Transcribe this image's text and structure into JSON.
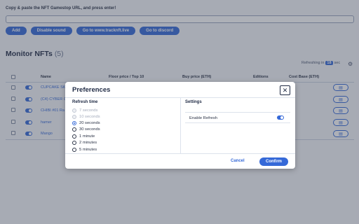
{
  "page": {
    "prompt": "Copy & paste the NFT Gamestop URL, and press enter!",
    "buttons": {
      "add": "Add",
      "disable_sound": "Disable sound",
      "go_tracknft": "Go to www.tracknft.live",
      "go_discord": "Go to discord"
    },
    "monitor": {
      "title": "Monitor NFTs",
      "count": "(5)",
      "refresh_prefix": "Refreshing in",
      "refresh_value": "18",
      "refresh_suffix": "sec"
    },
    "table": {
      "columns": [
        "Name",
        "Floor price / Top 10",
        "Buy price (ETH)",
        "Editions",
        "Cost Base (ETH)"
      ],
      "rows": [
        {
          "name": "CUPCAKE SK"
        },
        {
          "name": "(C4) CYBER C"
        },
        {
          "name": "CHIBI #01 Ra"
        },
        {
          "name": "hamer"
        },
        {
          "name": "Mango"
        }
      ]
    }
  },
  "modal": {
    "title": "Preferences",
    "close_label": "✕",
    "refresh_time": {
      "label": "Refresh time",
      "options": [
        {
          "label": "7 seconds",
          "disabled": true,
          "checked": false
        },
        {
          "label": "10 seconds",
          "disabled": true,
          "checked": false
        },
        {
          "label": "20 seconds",
          "disabled": false,
          "checked": true
        },
        {
          "label": "30 seconds",
          "disabled": false,
          "checked": false
        },
        {
          "label": "1 minute",
          "disabled": false,
          "checked": false
        },
        {
          "label": "2 minutes",
          "disabled": false,
          "checked": false
        },
        {
          "label": "5 minutes",
          "disabled": false,
          "checked": false
        }
      ]
    },
    "settings": {
      "label": "Settings",
      "enable_refresh_label": "Enable Refresh",
      "enable_refresh_on": true
    },
    "cancel_label": "Cancel",
    "confirm_label": "Confirm"
  },
  "colors": {
    "accent": "#3569d8",
    "overlay": "rgba(60,66,84,0.42)"
  }
}
